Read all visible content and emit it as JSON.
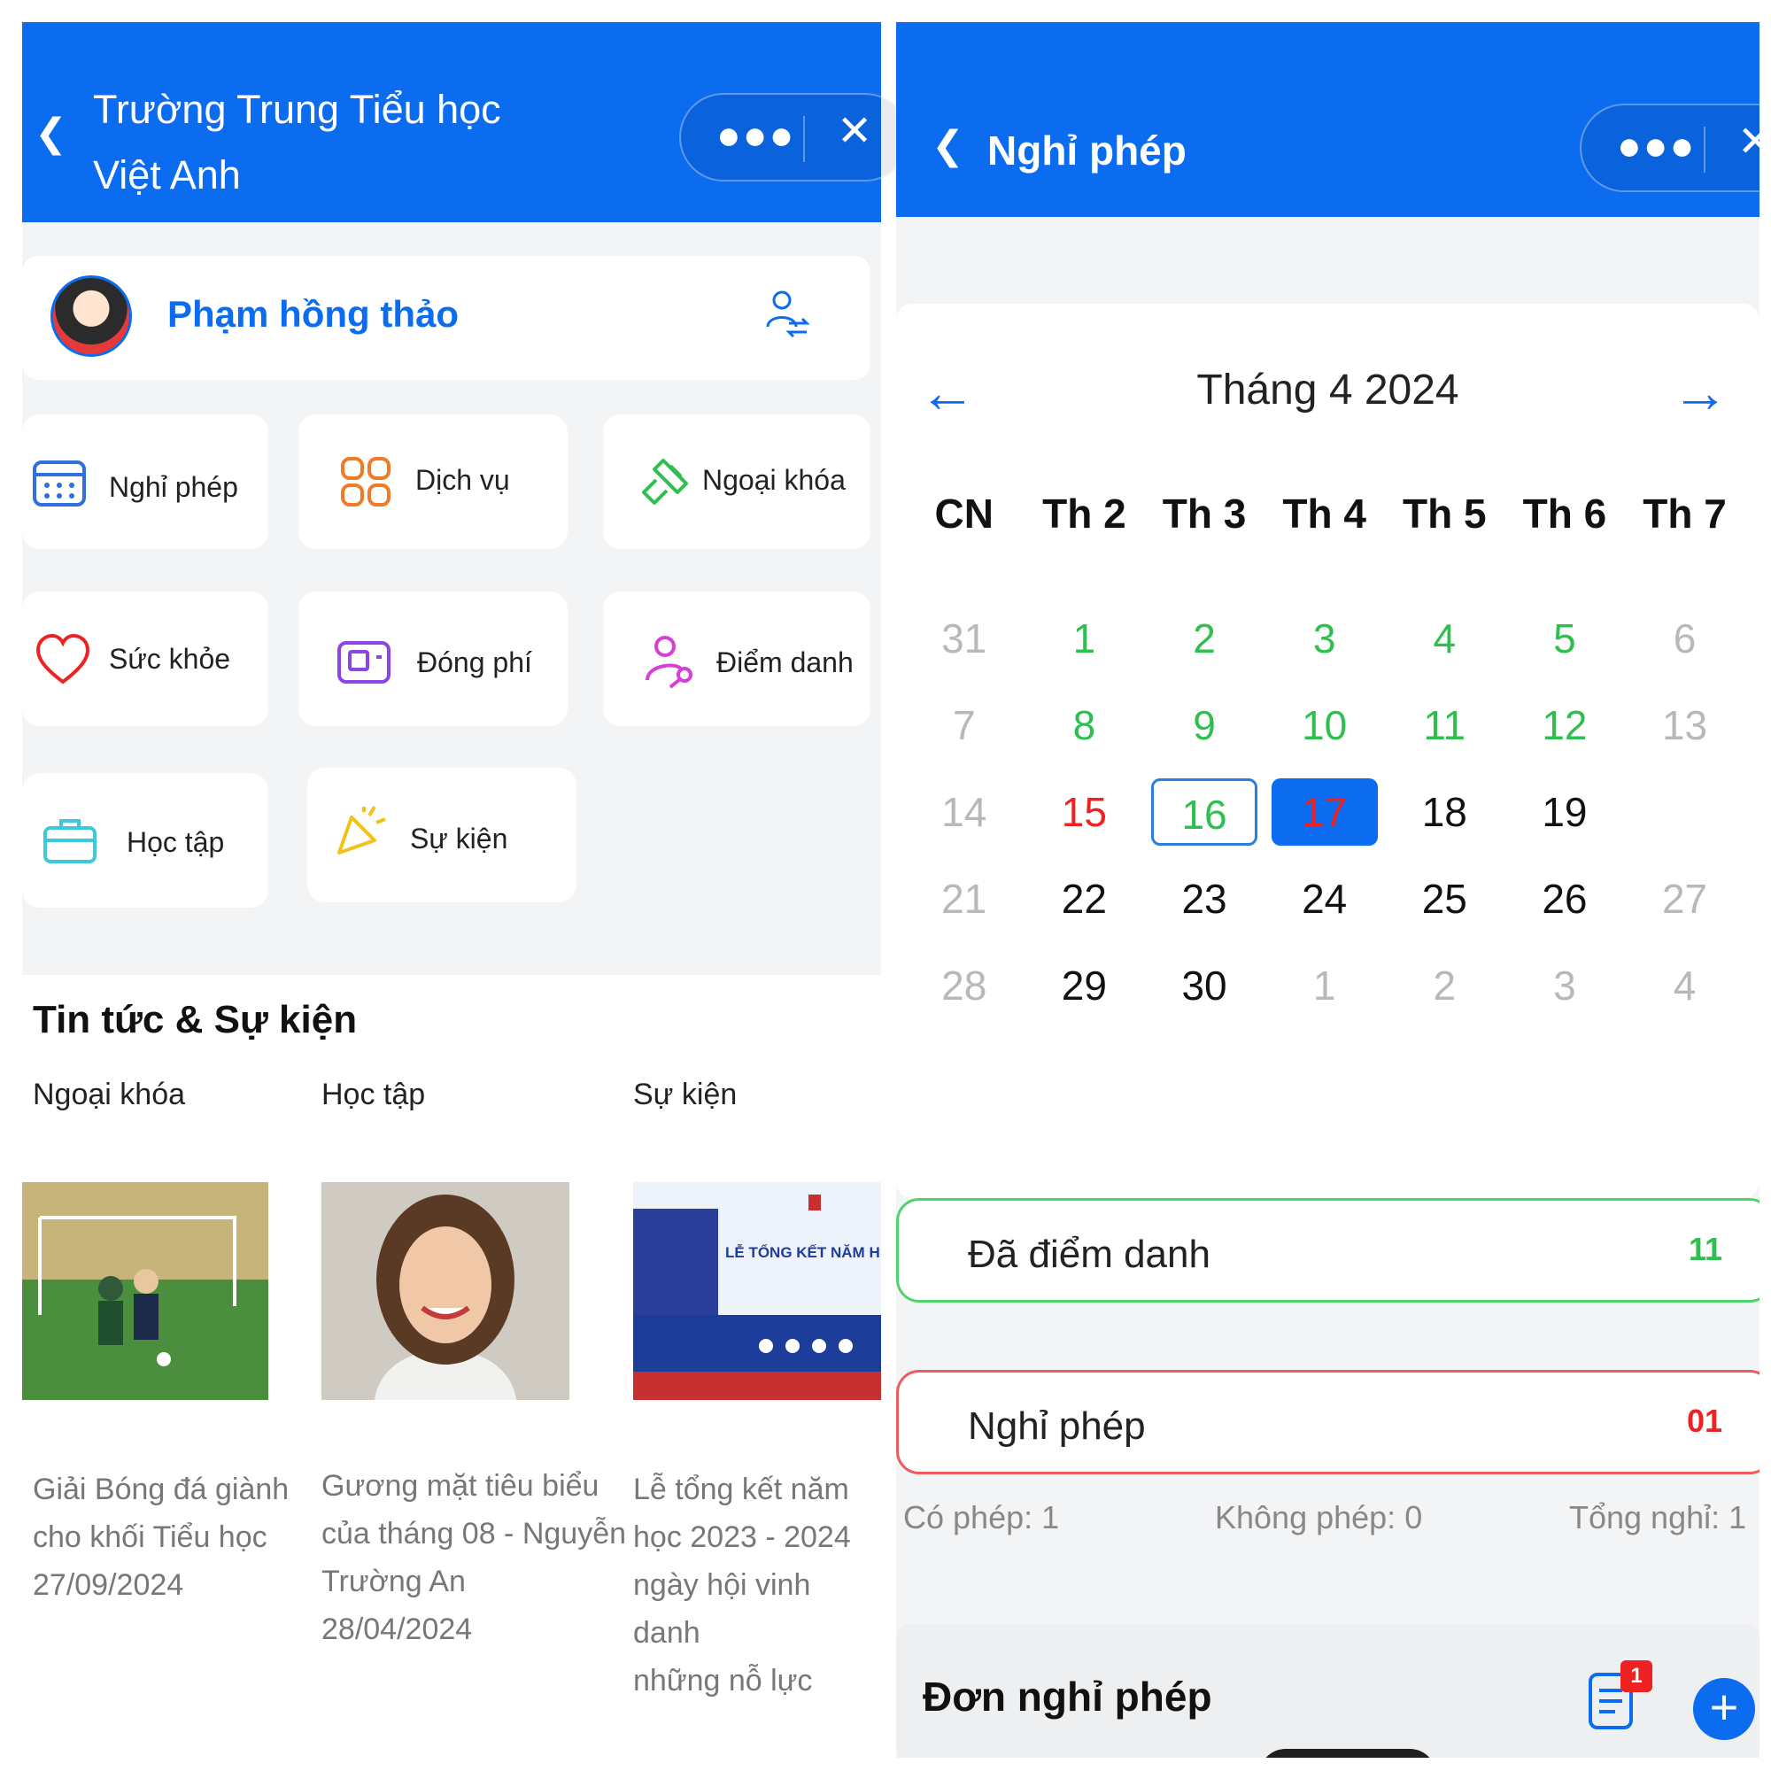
{
  "left": {
    "header": {
      "title": "Trường Trung Tiểu học Việt Anh"
    },
    "profile": {
      "name": "Phạm hồng thảo"
    },
    "tiles": [
      {
        "label": "Nghỉ phép",
        "icon": "calendar-icon",
        "color": "#2f6fe0"
      },
      {
        "label": "Dịch vụ",
        "icon": "qr-grid-icon",
        "color": "#f07a28"
      },
      {
        "label": "Ngoại khóa",
        "icon": "broom-icon",
        "color": "#2ec04e"
      },
      {
        "label": "Sức khỏe",
        "icon": "heart-icon",
        "color": "#ee2222"
      },
      {
        "label": "Đóng phí",
        "icon": "wallet-icon",
        "color": "#8b45e6"
      },
      {
        "label": "Điểm danh",
        "icon": "user-key-icon",
        "color": "#d83fd6"
      },
      {
        "label": "Học tập",
        "icon": "briefcase-icon",
        "color": "#3cc9dc"
      },
      {
        "label": "Sự kiện",
        "icon": "party-popper-icon",
        "color": "#f2c21b"
      }
    ],
    "news": {
      "title": "Tin tức & Sự kiện",
      "categories": [
        "Ngoại khóa",
        "Học tập",
        "Sự kiện"
      ],
      "items": [
        {
          "lines": [
            "Giải Bóng đá giành",
            "cho khối Tiểu học",
            "27/09/2024"
          ]
        },
        {
          "lines": [
            "Gương mặt tiêu biểu",
            "của tháng 08 - Nguyễn",
            "Trường An",
            "28/04/2024"
          ]
        },
        {
          "lines": [
            "Lễ tổng kết năm",
            "học 2023 - 2024",
            "ngày hội vinh danh",
            "những nỗ lực"
          ]
        }
      ],
      "poster_text": "LỄ TỔNG KẾT NĂM H"
    }
  },
  "right": {
    "header": {
      "title": "Nghỉ phép"
    },
    "calendar": {
      "month_label": "Tháng 4 2024",
      "weekdays": [
        "CN",
        "Th 2",
        "Th 3",
        "Th 4",
        "Th 5",
        "Th 6",
        "Th 7"
      ],
      "weeks": [
        [
          [
            "31",
            "muted"
          ],
          [
            "1",
            "green"
          ],
          [
            "2",
            "green"
          ],
          [
            "3",
            "green"
          ],
          [
            "4",
            "green"
          ],
          [
            "5",
            "green"
          ],
          [
            "6",
            "muted"
          ]
        ],
        [
          [
            "7",
            "muted"
          ],
          [
            "8",
            "green"
          ],
          [
            "9",
            "green"
          ],
          [
            "10",
            "green"
          ],
          [
            "11",
            "green"
          ],
          [
            "12",
            "green"
          ],
          [
            "13",
            "muted"
          ]
        ],
        [
          [
            "14",
            "muted"
          ],
          [
            "15",
            "red"
          ],
          [
            "16",
            "outlined"
          ],
          [
            "17",
            "selected"
          ],
          [
            "18",
            "normal"
          ],
          [
            "19",
            "normal"
          ],
          [
            "",
            ""
          ]
        ],
        [
          [
            "21",
            "muted"
          ],
          [
            "22",
            "normal"
          ],
          [
            "23",
            "normal"
          ],
          [
            "24",
            "normal"
          ],
          [
            "25",
            "normal"
          ],
          [
            "26",
            "normal"
          ],
          [
            "27",
            "muted"
          ]
        ],
        [
          [
            "28",
            "muted"
          ],
          [
            "29",
            "normal"
          ],
          [
            "30",
            "normal"
          ],
          [
            "1",
            "muted"
          ],
          [
            "2",
            "muted"
          ],
          [
            "3",
            "muted"
          ],
          [
            "4",
            "muted"
          ]
        ]
      ]
    },
    "stats": [
      {
        "label": "Đã điểm danh",
        "value": "11",
        "color": "#2ec04e"
      },
      {
        "label": "Nghỉ phép",
        "value": "01",
        "color": "#ee2222"
      }
    ],
    "summary": {
      "co_phep": "Có phép: 1",
      "khong_phep": "Không phép: 0",
      "tong_nghi": "Tổng nghỉ: 1"
    },
    "leave": {
      "title": "Đơn nghỉ phép",
      "badge": "1",
      "add": "+"
    }
  },
  "colors": {
    "primary": "#0b6cf0",
    "green": "#2ec04e",
    "red": "#ee2222"
  }
}
